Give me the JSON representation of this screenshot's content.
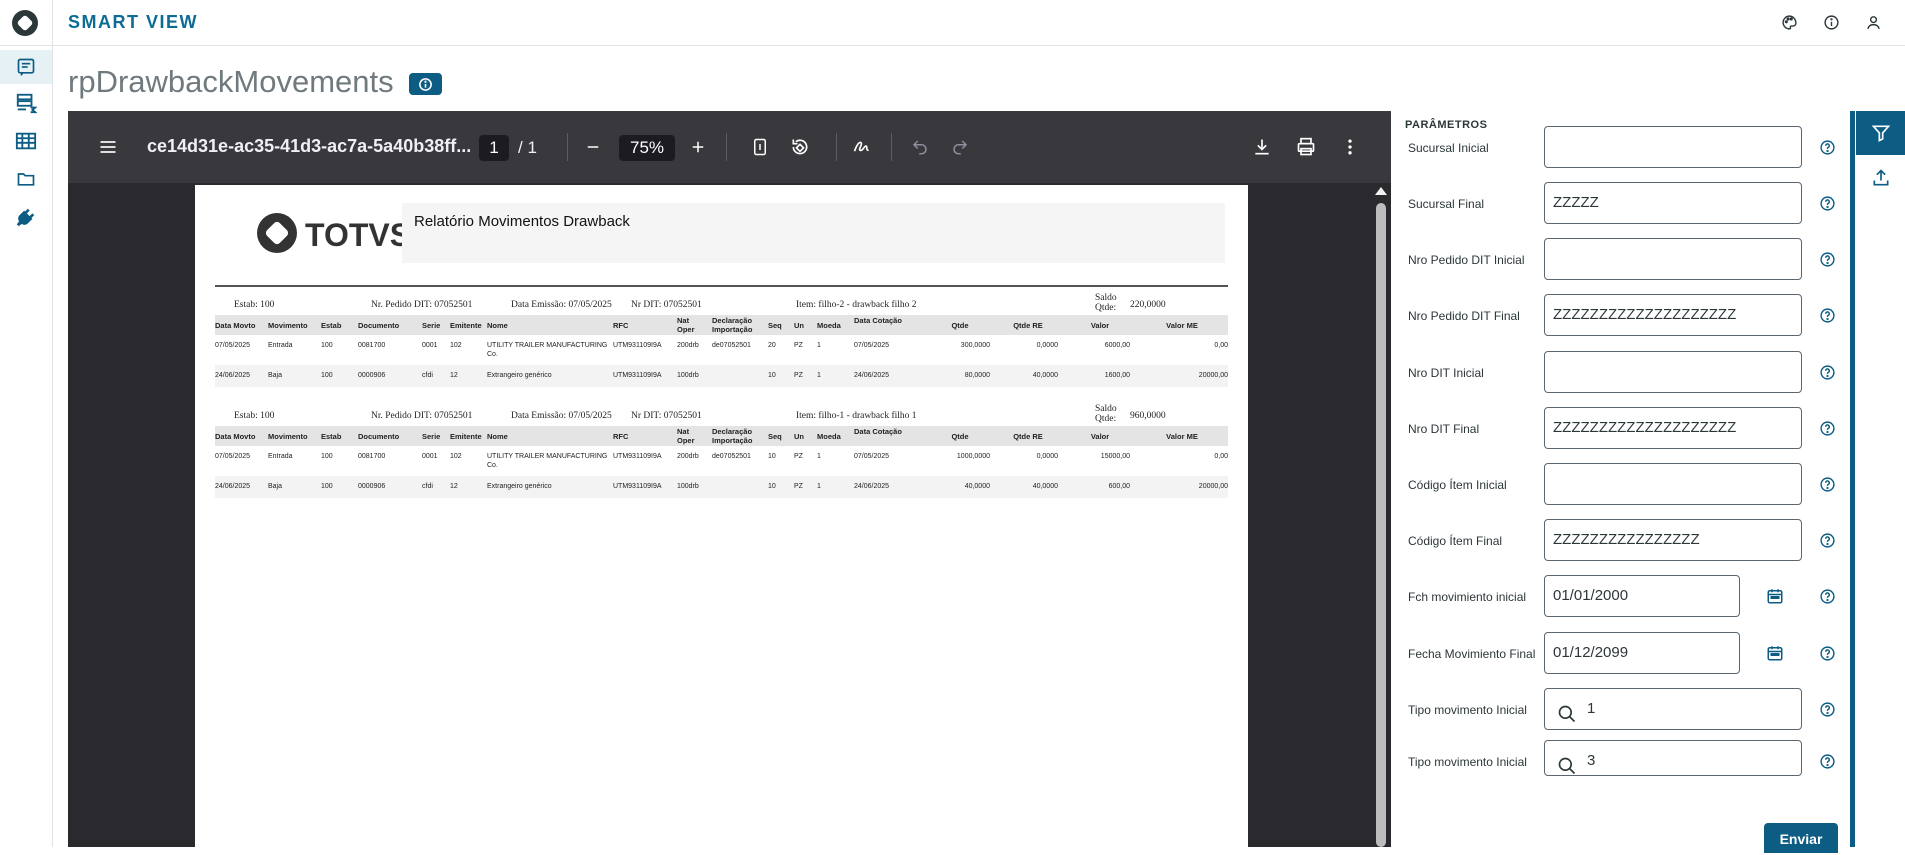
{
  "app": {
    "title": "SMART VIEW"
  },
  "page": {
    "title": "rpDrawbackMovements"
  },
  "icons": {
    "theme": "palette-icon",
    "info": "info-icon",
    "user": "user-icon",
    "nav": [
      "report-icon",
      "data-view-icon",
      "table-icon",
      "folder-icon",
      "plug-icon"
    ]
  },
  "viewer": {
    "doc_name": "ce14d31e-ac35-41d3-ac7a-5a40b38ff...",
    "page_current": "1",
    "page_total": "/ 1",
    "zoom": "75%"
  },
  "report": {
    "logo_text": "TOTVS",
    "title": "Relatório Movimentos Drawback",
    "columns": [
      "Data Movto",
      "Movimento",
      "Estab",
      "Documento",
      "Serie",
      "Emitente",
      "Nome",
      "RFC",
      "Nat Oper",
      "Declaração Importação",
      "Seq",
      "Un",
      "Moeda",
      "Data Cotação",
      "Qtde",
      "Qtde RE",
      "Valor",
      "Valor ME"
    ],
    "groups": [
      {
        "estab": "Estab:   100",
        "pedido": "Nr. Pedido DIT:  07052501",
        "emissao": "Data Emissão:  07/05/2025",
        "dit": "Nr DIT:   07052501",
        "item": "Item:  filho-2  -  drawback filho 2",
        "saldo_label": "Saldo Qtde:",
        "saldo": "220,0000",
        "rows": [
          [
            "07/05/2025",
            "Entrada",
            "100",
            "0081700",
            "0001",
            "102",
            "UTILITY TRAILER MANUFACTURING Co.",
            "UTM931109I9A",
            "200drb",
            "de07052501",
            "20",
            "PZ",
            "1",
            "07/05/2025",
            "300,0000",
            "0,0000",
            "6000,00",
            "0,00"
          ],
          [
            "24/06/2025",
            "Baja",
            "100",
            "0000906",
            "cfdi",
            "12",
            "Extrangeiro genérico",
            "UTM931109I9A",
            "100drb",
            "",
            "10",
            "PZ",
            "1",
            "24/06/2025",
            "80,0000",
            "40,0000",
            "1600,00",
            "20000,00"
          ]
        ]
      },
      {
        "estab": "Estab:   100",
        "pedido": "Nr. Pedido DIT:  07052501",
        "emissao": "Data Emissão:  07/05/2025",
        "dit": "Nr DIT:   07052501",
        "item": "Item:  filho-1  -  drawback filho 1",
        "saldo_label": "Saldo Qtde:",
        "saldo": "960,0000",
        "rows": [
          [
            "07/05/2025",
            "Entrada",
            "100",
            "0081700",
            "0001",
            "102",
            "UTILITY TRAILER MANUFACTURING Co.",
            "UTM931109I9A",
            "200drb",
            "de07052501",
            "10",
            "PZ",
            "1",
            "07/05/2025",
            "1000,0000",
            "0,0000",
            "15000,00",
            "0,00"
          ],
          [
            "24/06/2025",
            "Baja",
            "100",
            "0000906",
            "cfdi",
            "12",
            "Extrangeiro genérico",
            "UTM931109I9A",
            "100drb",
            "",
            "10",
            "PZ",
            "1",
            "24/06/2025",
            "40,0000",
            "40,0000",
            "600,00",
            "20000,00"
          ]
        ]
      }
    ]
  },
  "params": {
    "title": "PARÂMETROS",
    "fields": [
      {
        "label": "Sucursal Inicial",
        "value": ""
      },
      {
        "label": "Sucursal Final",
        "value": "ZZZZZ"
      },
      {
        "label": "Nro Pedido DIT Inicial",
        "value": ""
      },
      {
        "label": "Nro Pedido DIT Final",
        "value": "ZZZZZZZZZZZZZZZZZZZZ"
      },
      {
        "label": "Nro DIT Inicial",
        "value": ""
      },
      {
        "label": "Nro DIT Final",
        "value": "ZZZZZZZZZZZZZZZZZZZZ"
      },
      {
        "label": "Código Ítem Inicial",
        "value": ""
      },
      {
        "label": "Código Ítem Final",
        "value": "ZZZZZZZZZZZZZZZZ"
      },
      {
        "label": "Fch movimiento inicial",
        "value": "01/01/2000"
      },
      {
        "label": "Fecha Movimiento Final",
        "value": "01/12/2099"
      },
      {
        "label": "Tipo movimento Inicial",
        "value": "1"
      },
      {
        "label": "Tipo movimento Inicial",
        "value": "3"
      }
    ],
    "submit_label": "Enviar"
  },
  "colors": {
    "brand": "#0c5c84",
    "title_blue": "#0c6c94",
    "viewer_bg": "#2a2a2e",
    "toolbar_bg": "#38383d"
  }
}
